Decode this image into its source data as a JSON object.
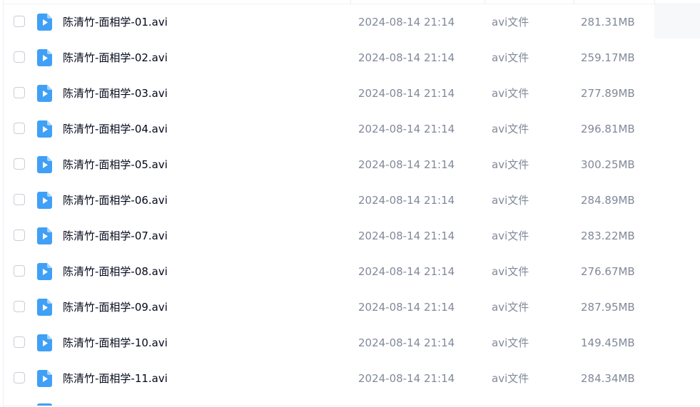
{
  "colors": {
    "icon_blue": "#3fa0f6",
    "name_text": "#03081a",
    "meta_text": "#818999",
    "checkbox_border": "#c9cdd6"
  },
  "file_icon": "video-file-icon",
  "files": [
    {
      "name": "陈清竹-面相学-01.avi",
      "date": "2024-08-14 21:14",
      "type": "avi文件",
      "size": "281.31MB"
    },
    {
      "name": "陈清竹-面相学-02.avi",
      "date": "2024-08-14 21:14",
      "type": "avi文件",
      "size": "259.17MB"
    },
    {
      "name": "陈清竹-面相学-03.avi",
      "date": "2024-08-14 21:14",
      "type": "avi文件",
      "size": "277.89MB"
    },
    {
      "name": "陈清竹-面相学-04.avi",
      "date": "2024-08-14 21:14",
      "type": "avi文件",
      "size": "296.81MB"
    },
    {
      "name": "陈清竹-面相学-05.avi",
      "date": "2024-08-14 21:14",
      "type": "avi文件",
      "size": "300.25MB"
    },
    {
      "name": "陈清竹-面相学-06.avi",
      "date": "2024-08-14 21:14",
      "type": "avi文件",
      "size": "284.89MB"
    },
    {
      "name": "陈清竹-面相学-07.avi",
      "date": "2024-08-14 21:14",
      "type": "avi文件",
      "size": "283.22MB"
    },
    {
      "name": "陈清竹-面相学-08.avi",
      "date": "2024-08-14 21:14",
      "type": "avi文件",
      "size": "276.67MB"
    },
    {
      "name": "陈清竹-面相学-09.avi",
      "date": "2024-08-14 21:14",
      "type": "avi文件",
      "size": "287.95MB"
    },
    {
      "name": "陈清竹-面相学-10.avi",
      "date": "2024-08-14 21:14",
      "type": "avi文件",
      "size": "149.45MB"
    },
    {
      "name": "陈清竹-面相学-11.avi",
      "date": "2024-08-14 21:14",
      "type": "avi文件",
      "size": "284.34MB"
    }
  ]
}
